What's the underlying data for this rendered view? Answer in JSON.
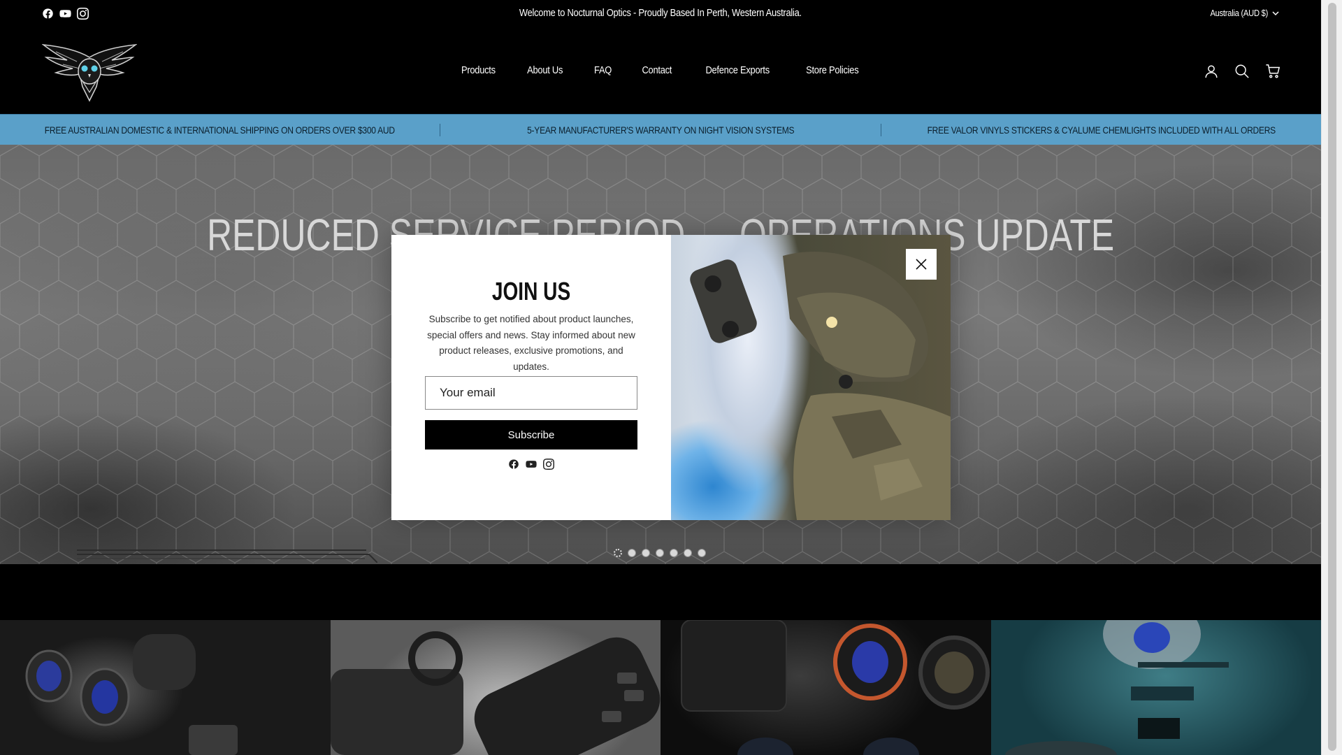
{
  "header": {
    "welcome": "Welcome to Nocturnal Optics - Proudly Based In Perth, Western Australia.",
    "currency": "Australia (AUD $)",
    "social_icons": [
      "facebook-icon",
      "youtube-icon",
      "instagram-icon"
    ],
    "nav": [
      "Products",
      "About Us",
      "FAQ",
      "Contact",
      "Defence Exports",
      "Store Policies"
    ],
    "icons": [
      "account-icon",
      "search-icon",
      "cart-icon"
    ]
  },
  "announcements": [
    "FREE AUSTRALIAN DOMESTIC & INTERNATIONAL SHIPPING ON ORDERS OVER $300 AUD",
    "5-YEAR MANUFACTURER'S WARRANTY ON NIGHT VISION SYSTEMS",
    "FREE VALOR VINYLS STICKERS & CYALUME CHEMLIGHTS INCLUDED WITH ALL ORDERS"
  ],
  "hero": {
    "title": "REDUCED SERVICE PERIOD — OPERATIONS UPDATE",
    "slide_count": 7,
    "active_slide": 1
  },
  "popup": {
    "title": "JOIN US",
    "description": "Subscribe to get notified about product launches, special offers and news. Stay informed about new product releases, exclusive promotions, and updates.",
    "email_placeholder": "Your email",
    "subscribe_label": "Subscribe"
  },
  "colors": {
    "announcement_bar": "#5aa0c9",
    "header_bg": "#000000",
    "button_bg": "#000000"
  }
}
